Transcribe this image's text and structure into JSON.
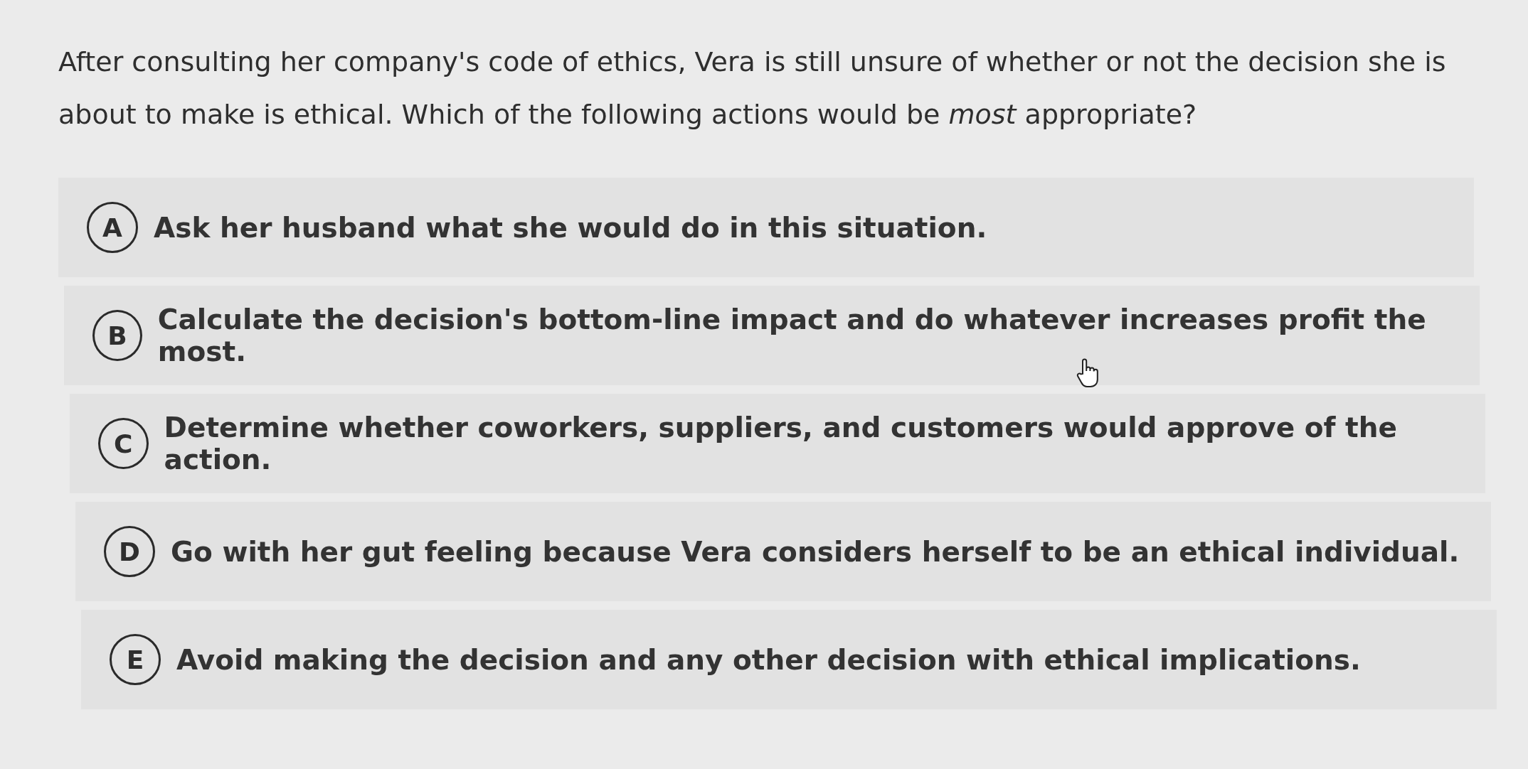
{
  "question": "After consulting her company's code of ethics, Vera is still unsure of whether or not the decision she is about to make is ethical. Which of the following actions would be *most* appropriate?",
  "options": [
    {
      "letter": "A",
      "text": "Ask her husband what she would do in this situation."
    },
    {
      "letter": "B",
      "text": "Calculate the decision's bottom-line impact and do whatever increases profit the most."
    },
    {
      "letter": "C",
      "text": "Determine whether coworkers, suppliers, and customers would approve of the action."
    },
    {
      "letter": "D",
      "text": "Go with her gut feeling because Vera considers herself to be an ethical individual."
    },
    {
      "letter": "E",
      "text": "Avoid making the decision and any other decision with ethical implications."
    }
  ]
}
